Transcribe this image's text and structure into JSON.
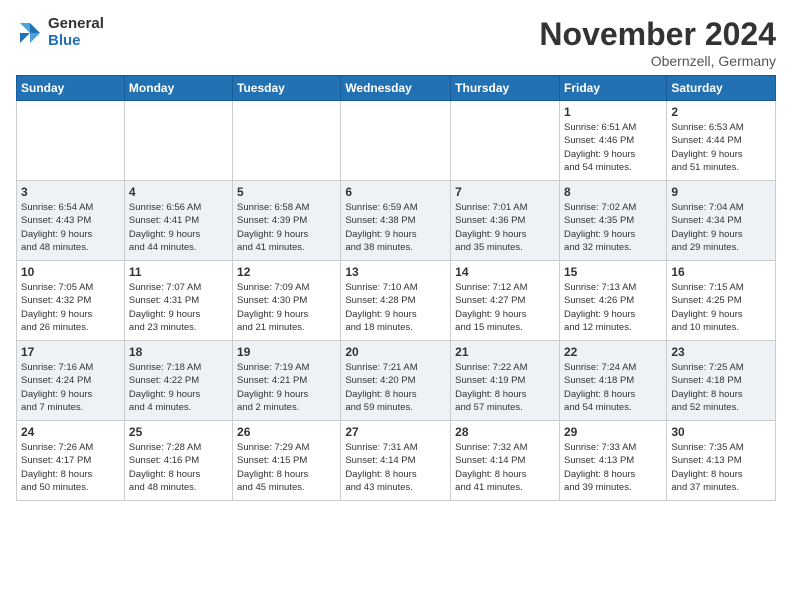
{
  "header": {
    "logo_general": "General",
    "logo_blue": "Blue",
    "title": "November 2024",
    "location": "Obernzell, Germany"
  },
  "weekdays": [
    "Sunday",
    "Monday",
    "Tuesday",
    "Wednesday",
    "Thursday",
    "Friday",
    "Saturday"
  ],
  "weeks": [
    [
      {
        "day": "",
        "info": ""
      },
      {
        "day": "",
        "info": ""
      },
      {
        "day": "",
        "info": ""
      },
      {
        "day": "",
        "info": ""
      },
      {
        "day": "",
        "info": ""
      },
      {
        "day": "1",
        "info": "Sunrise: 6:51 AM\nSunset: 4:46 PM\nDaylight: 9 hours\nand 54 minutes."
      },
      {
        "day": "2",
        "info": "Sunrise: 6:53 AM\nSunset: 4:44 PM\nDaylight: 9 hours\nand 51 minutes."
      }
    ],
    [
      {
        "day": "3",
        "info": "Sunrise: 6:54 AM\nSunset: 4:43 PM\nDaylight: 9 hours\nand 48 minutes."
      },
      {
        "day": "4",
        "info": "Sunrise: 6:56 AM\nSunset: 4:41 PM\nDaylight: 9 hours\nand 44 minutes."
      },
      {
        "day": "5",
        "info": "Sunrise: 6:58 AM\nSunset: 4:39 PM\nDaylight: 9 hours\nand 41 minutes."
      },
      {
        "day": "6",
        "info": "Sunrise: 6:59 AM\nSunset: 4:38 PM\nDaylight: 9 hours\nand 38 minutes."
      },
      {
        "day": "7",
        "info": "Sunrise: 7:01 AM\nSunset: 4:36 PM\nDaylight: 9 hours\nand 35 minutes."
      },
      {
        "day": "8",
        "info": "Sunrise: 7:02 AM\nSunset: 4:35 PM\nDaylight: 9 hours\nand 32 minutes."
      },
      {
        "day": "9",
        "info": "Sunrise: 7:04 AM\nSunset: 4:34 PM\nDaylight: 9 hours\nand 29 minutes."
      }
    ],
    [
      {
        "day": "10",
        "info": "Sunrise: 7:05 AM\nSunset: 4:32 PM\nDaylight: 9 hours\nand 26 minutes."
      },
      {
        "day": "11",
        "info": "Sunrise: 7:07 AM\nSunset: 4:31 PM\nDaylight: 9 hours\nand 23 minutes."
      },
      {
        "day": "12",
        "info": "Sunrise: 7:09 AM\nSunset: 4:30 PM\nDaylight: 9 hours\nand 21 minutes."
      },
      {
        "day": "13",
        "info": "Sunrise: 7:10 AM\nSunset: 4:28 PM\nDaylight: 9 hours\nand 18 minutes."
      },
      {
        "day": "14",
        "info": "Sunrise: 7:12 AM\nSunset: 4:27 PM\nDaylight: 9 hours\nand 15 minutes."
      },
      {
        "day": "15",
        "info": "Sunrise: 7:13 AM\nSunset: 4:26 PM\nDaylight: 9 hours\nand 12 minutes."
      },
      {
        "day": "16",
        "info": "Sunrise: 7:15 AM\nSunset: 4:25 PM\nDaylight: 9 hours\nand 10 minutes."
      }
    ],
    [
      {
        "day": "17",
        "info": "Sunrise: 7:16 AM\nSunset: 4:24 PM\nDaylight: 9 hours\nand 7 minutes."
      },
      {
        "day": "18",
        "info": "Sunrise: 7:18 AM\nSunset: 4:22 PM\nDaylight: 9 hours\nand 4 minutes."
      },
      {
        "day": "19",
        "info": "Sunrise: 7:19 AM\nSunset: 4:21 PM\nDaylight: 9 hours\nand 2 minutes."
      },
      {
        "day": "20",
        "info": "Sunrise: 7:21 AM\nSunset: 4:20 PM\nDaylight: 8 hours\nand 59 minutes."
      },
      {
        "day": "21",
        "info": "Sunrise: 7:22 AM\nSunset: 4:19 PM\nDaylight: 8 hours\nand 57 minutes."
      },
      {
        "day": "22",
        "info": "Sunrise: 7:24 AM\nSunset: 4:18 PM\nDaylight: 8 hours\nand 54 minutes."
      },
      {
        "day": "23",
        "info": "Sunrise: 7:25 AM\nSunset: 4:18 PM\nDaylight: 8 hours\nand 52 minutes."
      }
    ],
    [
      {
        "day": "24",
        "info": "Sunrise: 7:26 AM\nSunset: 4:17 PM\nDaylight: 8 hours\nand 50 minutes."
      },
      {
        "day": "25",
        "info": "Sunrise: 7:28 AM\nSunset: 4:16 PM\nDaylight: 8 hours\nand 48 minutes."
      },
      {
        "day": "26",
        "info": "Sunrise: 7:29 AM\nSunset: 4:15 PM\nDaylight: 8 hours\nand 45 minutes."
      },
      {
        "day": "27",
        "info": "Sunrise: 7:31 AM\nSunset: 4:14 PM\nDaylight: 8 hours\nand 43 minutes."
      },
      {
        "day": "28",
        "info": "Sunrise: 7:32 AM\nSunset: 4:14 PM\nDaylight: 8 hours\nand 41 minutes."
      },
      {
        "day": "29",
        "info": "Sunrise: 7:33 AM\nSunset: 4:13 PM\nDaylight: 8 hours\nand 39 minutes."
      },
      {
        "day": "30",
        "info": "Sunrise: 7:35 AM\nSunset: 4:13 PM\nDaylight: 8 hours\nand 37 minutes."
      }
    ]
  ]
}
